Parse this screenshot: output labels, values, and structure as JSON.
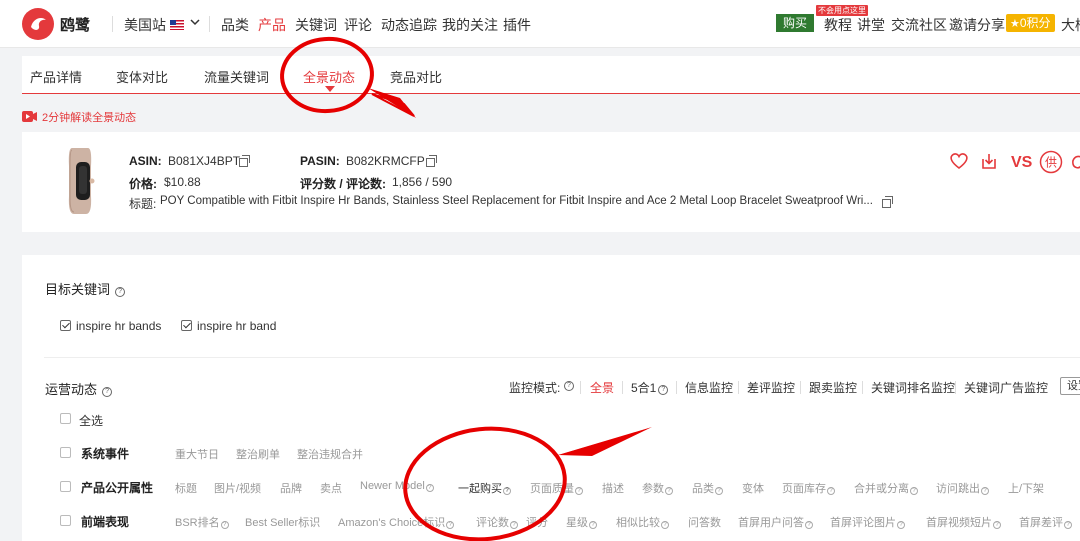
{
  "nav": {
    "logo_text": "鸥鹭",
    "site": "美国站",
    "items": [
      "品类",
      "产品",
      "关键词",
      "评论",
      "动态追踪",
      "我的关注",
      "插件"
    ],
    "active_item": "产品",
    "buy_label": "购买",
    "buy_badge": "不会用点这里",
    "right_items": [
      "教程",
      "讲堂",
      "交流社区",
      "邀请分享"
    ],
    "points": "0积分",
    "user": "大楠"
  },
  "tabs": {
    "items": [
      "产品详情",
      "变体对比",
      "流量关键词",
      "全景动态",
      "竞品对比"
    ],
    "active": "全景动态"
  },
  "guide_link": "2分钟解读全景动态",
  "product": {
    "asin_label": "ASIN:",
    "asin": "B081XJ4BPT",
    "pasin_label": "PASIN:",
    "pasin": "B082KRMCFP",
    "price_label": "价格:",
    "price": "$10.88",
    "rating_label": "评分数 / 评论数:",
    "rating": "1,856 / 590",
    "title_label": "标题:",
    "title": "POY Compatible with Fitbit Inspire Hr Bands, Stainless Steel Replacement for Fitbit Inspire and Ace 2 Metal Loop Bracelet Sweatproof Wri...",
    "vs_label": "VS",
    "supply_label": "供"
  },
  "keywords": {
    "title": "目标关键词",
    "items": [
      "inspire hr bands",
      "inspire hr band"
    ]
  },
  "ops": {
    "title": "运营动态",
    "mode_label": "监控模式:",
    "modes": [
      "全景",
      "5合1",
      "信息监控",
      "差评监控",
      "跟卖监控",
      "关键词排名监控",
      "关键词广告监控"
    ],
    "active_mode": "全景",
    "settings_label": "设置",
    "select_all": "全选",
    "rows": [
      {
        "label": "系统事件",
        "options": [
          "重大节日",
          "整治刷单",
          "整治违规合并"
        ]
      },
      {
        "label": "产品公开属性",
        "options": [
          "标题",
          "图片/视频",
          "品牌",
          "卖点",
          "Newer Model",
          "一起购买",
          "页面质量",
          "描述",
          "参数",
          "品类",
          "变体",
          "页面库存",
          "合并或分离",
          "访问跳出",
          "上/下架"
        ]
      },
      {
        "label": "前端表现",
        "options": [
          "BSR排名",
          "Best Seller标识",
          "Amazon's Choice标识",
          "评论数",
          "评分",
          "星级",
          "相似比较",
          "问答数",
          "首屏用户问答",
          "首屏评论图片",
          "首屏视频短片",
          "首屏差评"
        ]
      }
    ]
  },
  "colors": {
    "brand": "#e4393c",
    "buy": "#2f7a30",
    "points": "#f5b400"
  }
}
